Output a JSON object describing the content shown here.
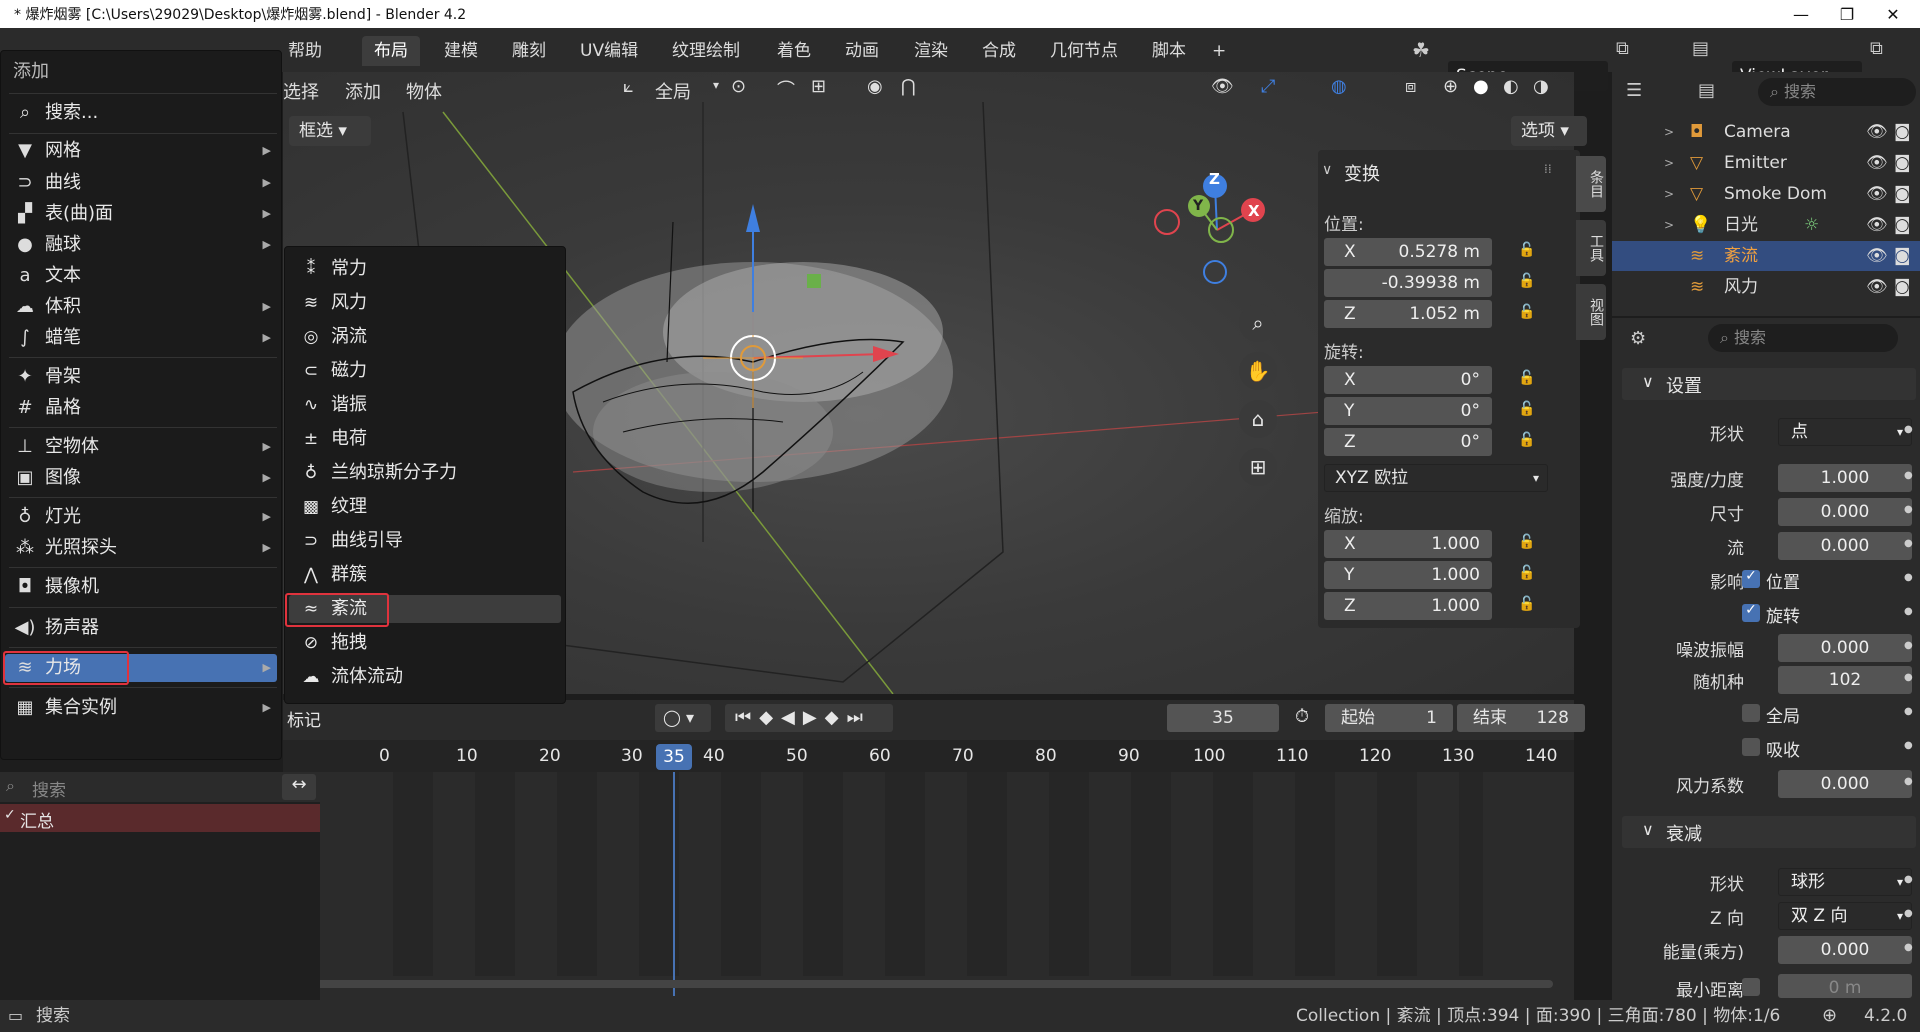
{
  "window": {
    "title": "* 爆炸烟雾 [C:\\Users\\29029\\Desktop\\爆炸烟雾.blend] - Blender 4.2",
    "minimize": "—",
    "maximize": "❐",
    "close": "✕"
  },
  "menubar": {
    "help": "帮助",
    "workspaces": [
      "布局",
      "建模",
      "雕刻",
      "UV编辑",
      "纹理绘制",
      "着色",
      "动画",
      "渲染",
      "合成",
      "几何节点",
      "脚本"
    ],
    "add_tab": "+",
    "scene": "Scene",
    "view_layer": "ViewLayer"
  },
  "viewport_header": {
    "select": "选择",
    "add": "添加",
    "object": "物体",
    "transform_orientation": "全局",
    "select_mode": "框选",
    "options": "选项"
  },
  "add_menu": {
    "title": "添加",
    "search": "搜索...",
    "items": [
      {
        "label": "网格",
        "icon": "mesh-icon"
      },
      {
        "label": "曲线",
        "icon": "curve-icon"
      },
      {
        "label": "表(曲)面",
        "icon": "surface-icon"
      },
      {
        "label": "融球",
        "icon": "metaball-icon"
      },
      {
        "label": "文本",
        "icon": "text-icon"
      },
      {
        "label": "体积",
        "icon": "volume-icon"
      },
      {
        "label": "蜡笔",
        "icon": "grease-pencil-icon"
      },
      {
        "label": "骨架",
        "icon": "armature-icon"
      },
      {
        "label": "晶格",
        "icon": "lattice-icon"
      },
      {
        "label": "空物体",
        "icon": "empty-icon"
      },
      {
        "label": "图像",
        "icon": "image-icon"
      },
      {
        "label": "灯光",
        "icon": "light-icon"
      },
      {
        "label": "光照探头",
        "icon": "light-probe-icon"
      },
      {
        "label": "摄像机",
        "icon": "camera-icon"
      },
      {
        "label": "扬声器",
        "icon": "speaker-icon"
      },
      {
        "label": "力场",
        "icon": "force-field-icon"
      },
      {
        "label": "集合实例",
        "icon": "collection-instance-icon"
      }
    ]
  },
  "force_submenu": {
    "items": [
      "常力",
      "风力",
      "涡流",
      "磁力",
      "谐振",
      "电荷",
      "兰纳琼斯分子力",
      "纹理",
      "曲线引导",
      "群簇",
      "紊流",
      "拖拽",
      "流体流动"
    ],
    "selected": "紊流"
  },
  "transform_panel": {
    "title": "变换",
    "location_label": "位置:",
    "location": [
      {
        "axis": "X",
        "value": "0.5278 m"
      },
      {
        "axis": "",
        "value": "-0.39938 m"
      },
      {
        "axis": "Z",
        "value": "1.052 m"
      }
    ],
    "rotation_label": "旋转:",
    "rotation": [
      {
        "axis": "X",
        "value": "0°"
      },
      {
        "axis": "Y",
        "value": "0°"
      },
      {
        "axis": "Z",
        "value": "0°"
      }
    ],
    "rotation_mode": "XYZ 欧拉",
    "scale_label": "缩放:",
    "scale": [
      {
        "axis": "X",
        "value": "1.000"
      },
      {
        "axis": "Y",
        "value": "1.000"
      },
      {
        "axis": "Z",
        "value": "1.000"
      }
    ]
  },
  "side_tabs": [
    "条目",
    "工具",
    "视图"
  ],
  "gizmo": {
    "z": "Z",
    "y": "Y",
    "x": "X"
  },
  "outliner": {
    "search_placeholder": "搜索",
    "rows": [
      {
        "name": "Camera",
        "icon": "camera-icon"
      },
      {
        "name": "Emitter",
        "icon": "mesh-icon"
      },
      {
        "name": "Smoke Dom",
        "icon": "mesh-icon"
      },
      {
        "name": "日光",
        "icon": "light-icon"
      },
      {
        "name": "紊流",
        "icon": "force-field-icon",
        "selected": true
      },
      {
        "name": "风力",
        "icon": "force-field-icon"
      }
    ]
  },
  "properties": {
    "search_placeholder": "搜索",
    "settings_header": "设置",
    "shape_label": "形状",
    "shape_value": "点",
    "strength_label": "强度/力度",
    "strength": "1.000",
    "size_label": "尺寸",
    "size": "0.000",
    "flow_label": "流",
    "flow": "0.000",
    "affect_label": "影响",
    "affect_location": "位置",
    "affect_rotation": "旋转",
    "noise_label": "噪波振幅",
    "noise": "0.000",
    "seed_label": "随机种",
    "seed": "102",
    "global": "全局",
    "absorption": "吸收",
    "wind_factor_label": "风力系数",
    "wind_factor": "0.000",
    "falloff_header": "衰减",
    "falloff_shape_label": "形状",
    "falloff_shape": "球形",
    "z_dir_label": "Z 向",
    "z_dir": "双 Z 向",
    "power_label": "能量(乘方)",
    "power": "0.000",
    "min_distance_label": "最小距离",
    "min_distance": "0 m"
  },
  "timeline": {
    "marker": "标记",
    "current_frame": "35",
    "start_label": "起始",
    "start": "1",
    "end_label": "结束",
    "end": "128",
    "ruler": [
      "0",
      "10",
      "20",
      "30",
      "35",
      "40",
      "50",
      "60",
      "70",
      "80",
      "90",
      "100",
      "110",
      "120",
      "130",
      "140"
    ],
    "search_placeholder": "搜索",
    "summary": "汇总"
  },
  "statusbar": {
    "search": "搜索",
    "info": "Collection | 紊流 | 顶点:394 | 面:390 | 三角面:780 | 物体:1/6",
    "version": "4.2.0"
  },
  "colors": {
    "accent": "#4772b3",
    "highlight": "#e0333d",
    "x_axis": "#e0444e",
    "y_axis": "#80b54a",
    "z_axis": "#3f7fe0"
  }
}
